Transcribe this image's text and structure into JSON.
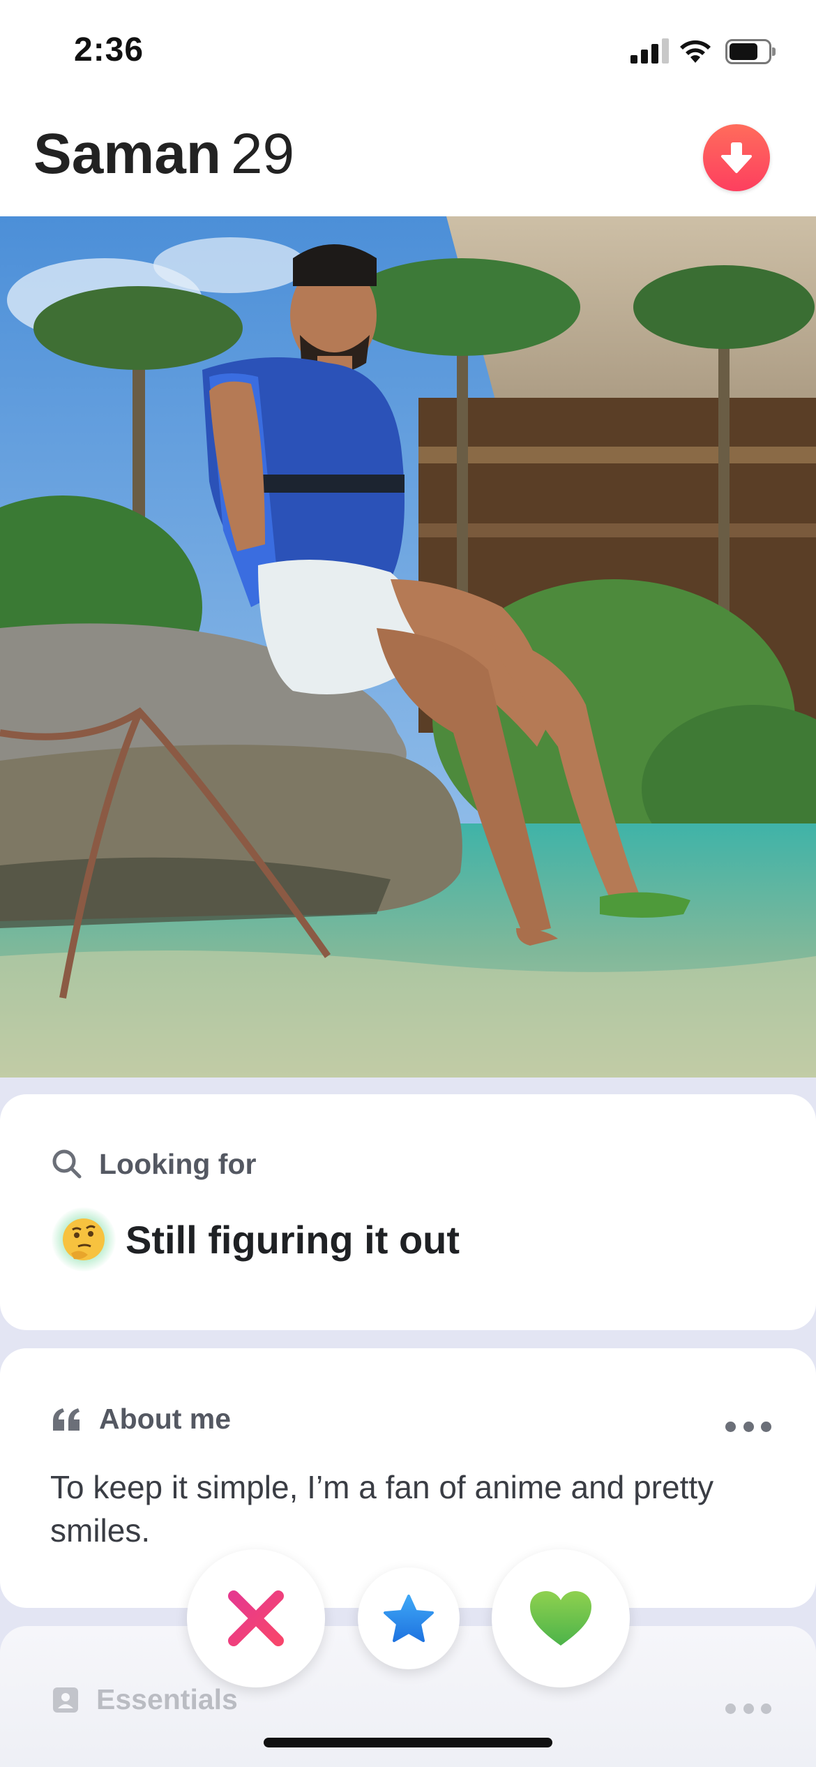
{
  "status_bar": {
    "time": "2:36",
    "signal_icon": "cellular-signal-icon",
    "wifi_icon": "wifi-icon",
    "battery_icon": "battery-icon"
  },
  "profile": {
    "name": "Saman",
    "age": "29",
    "collapse_icon": "arrow-down-icon"
  },
  "photo": {
    "description_icon": "profile-photo"
  },
  "looking_for": {
    "label": "Looking for",
    "icon": "search-icon",
    "emoji": "thinking-face-emoji",
    "value": "Still figuring it out"
  },
  "about_me": {
    "label": "About me",
    "icon": "quote-icon",
    "text": "To keep it simple, I’m a fan of anime and pretty smiles.",
    "more_icon": "more-dots-icon"
  },
  "essentials": {
    "label": "Essentials",
    "icon": "id-card-icon",
    "more_icon": "more-dots-icon"
  },
  "actions": {
    "nope_icon": "x-icon",
    "super_like_icon": "star-icon",
    "like_icon": "heart-icon"
  },
  "colors": {
    "nope": "#ef3e7a",
    "super_like": "#2d8cf0",
    "like": "#7ac943",
    "brand_red": "#fd4a5c"
  }
}
